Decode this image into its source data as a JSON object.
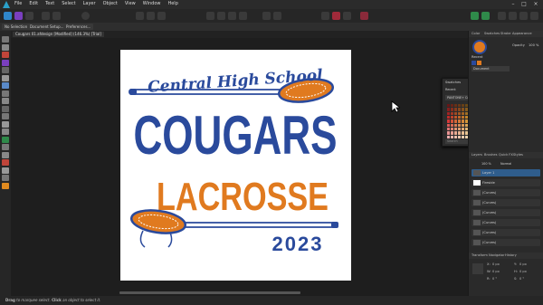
{
  "menu": {
    "items": [
      "File",
      "Edit",
      "Text",
      "Select",
      "Layer",
      "Object",
      "View",
      "Window",
      "Help"
    ]
  },
  "context": {
    "tabs": [
      "No Selection",
      "Document Setup...",
      "Preferences..."
    ]
  },
  "document": {
    "tab_title": "Cougars 01.afdesign [Modified] (146.3%) [Trial]"
  },
  "artwork": {
    "line1": "Central High School",
    "line2": "COUGARS",
    "line3": "LACROSSE",
    "line4": "2023",
    "colors": {
      "blue": "#2a4a9c",
      "orange": "#e07a1f",
      "white": "#ffffff"
    }
  },
  "right_panel": {
    "top_tabs": [
      "Color",
      "Swatches",
      "Stroke",
      "Appearance"
    ],
    "opacity_label": "Opacity",
    "opacity_value": "100 %",
    "recent_label": "Recent",
    "palette_label": "Document",
    "layer_tabs": [
      "Layers",
      "Brushes",
      "Quick FX",
      "Styles"
    ],
    "layer_opacity": "100 %",
    "blend_mode": "Normal",
    "layers": [
      "Layer 1",
      "Fireside",
      "(Curves)",
      "(Curves)",
      "(Curves)",
      "(Curves)",
      "(Curves)",
      "(Curves)"
    ],
    "transform_tabs": [
      "Transform",
      "Navigator",
      "History"
    ],
    "transform_labels": [
      "X:",
      "Y:",
      "W:",
      "H:",
      "R:",
      "S:"
    ],
    "transform_values": [
      "0 px",
      "0 px",
      "0 px",
      "0 px",
      "0 °",
      "0 °"
    ]
  },
  "swatches_panel": {
    "title": "Swatches",
    "recent_label": "Recent",
    "palette_name": "PANTONE+ Color Bridge Coate",
    "search_placeholder": "Search"
  },
  "status": {
    "hint_prefix": "Drag",
    "hint_text": "to marquee select.",
    "hint_click": "Click",
    "hint_rest": "an object to select it."
  }
}
